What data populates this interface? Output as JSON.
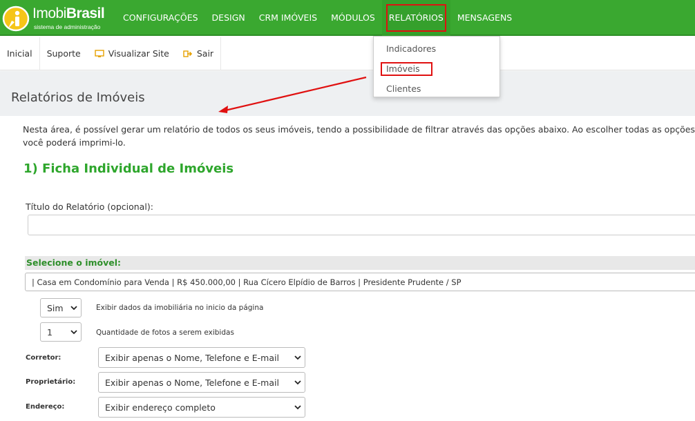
{
  "brand": {
    "name_light": "Imobi",
    "name_bold": "Brasil",
    "tagline": "sistema de administração"
  },
  "colors": {
    "nav_green": "#3aa830",
    "highlight_red": "#e01010",
    "section_green": "#2ea62c"
  },
  "topnav": {
    "items": [
      {
        "label": "CONFIGURAÇÕES"
      },
      {
        "label": "DESIGN"
      },
      {
        "label": "CRM IMÓVEIS"
      },
      {
        "label": "MÓDULOS"
      },
      {
        "label": "RELATÓRIOS",
        "active": true
      },
      {
        "label": "MENSAGENS"
      }
    ]
  },
  "dropdown": {
    "items": [
      {
        "label": "Indicadores"
      },
      {
        "label": "Imóveis",
        "highlighted": true
      },
      {
        "label": "Clientes"
      }
    ]
  },
  "subnav": {
    "items": [
      {
        "label": "Inicial"
      },
      {
        "label": "Suporte"
      },
      {
        "label": "Visualizar Site",
        "icon": "monitor-icon"
      },
      {
        "label": "Sair",
        "icon": "logout-icon"
      }
    ]
  },
  "page": {
    "title": "Relatórios de Imóveis",
    "intro_line1": "Nesta área, é possível gerar um relatório de todos os seus imóveis, tendo a possibilidade de filtrar através das opções abaixo. Ao escolher todas as opções",
    "intro_line2": "você poderá imprimi-lo.",
    "section_title": "1) Ficha Individual de Imóveis",
    "report_title_label": "Título do Relatório (opcional):",
    "report_title_value": "",
    "select_imovel_label": "Selecione o imóvel:",
    "select_imovel_value": "| Casa em Condomínio para Venda | R$ 450.000,00 | Rua Cícero Elpídio de Barros | Presidente Prudente / SP",
    "options": {
      "show_agency": {
        "value": "Sim",
        "label": "Exibir dados da imobiliária no inicio da página"
      },
      "photo_count": {
        "value": "1",
        "label": "Quantidade de fotos a serem exibidas"
      }
    },
    "fields": [
      {
        "label": "Corretor:",
        "value": "Exibir apenas o Nome, Telefone e E-mail"
      },
      {
        "label": "Proprietário:",
        "value": "Exibir apenas o Nome, Telefone e E-mail"
      },
      {
        "label": "Endereço:",
        "value": "Exibir endereço completo"
      }
    ]
  }
}
